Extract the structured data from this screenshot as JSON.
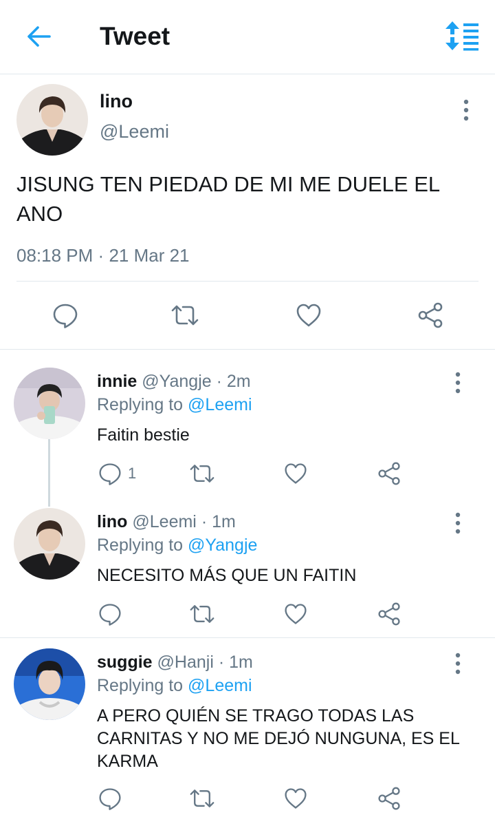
{
  "header": {
    "title": "Tweet",
    "accent": "#1da1f2",
    "back_icon": "arrow-left-icon",
    "sort_icon": "sort-arrows-icon"
  },
  "main_tweet": {
    "name": "lino",
    "handle": "@Leemi",
    "text": "JISUNG TEN PIEDAD DE MI ME DUELE EL ANO",
    "time": "08:18 PM",
    "sep": "·",
    "date": "21 Mar 21",
    "actions": [
      "reply-icon",
      "retweet-icon",
      "like-icon",
      "share-icon"
    ]
  },
  "replies": [
    {
      "name": "innie",
      "handle": "@Yangje",
      "sep": "·",
      "time": "2m",
      "replying_prefix": "Replying to",
      "replying_to": "@Leemi",
      "text": "Faitin bestie",
      "reply_count": "1"
    },
    {
      "name": "lino",
      "handle": "@Leemi",
      "sep": "·",
      "time": "1m",
      "replying_prefix": "Replying to",
      "replying_to": "@Yangje",
      "text": "NECESITO MÁS QUE UN FAITIN",
      "reply_count": ""
    },
    {
      "name": "suggie",
      "handle": "@Hanji",
      "sep": "·",
      "time": "1m",
      "replying_prefix": "Replying to",
      "replying_to": "@Leemi",
      "text": "A PERO QUIÉN SE TRAGO TODAS LAS CARNITAS Y NO ME DEJÓ NUNGUNA, ES EL KARMA",
      "reply_count": ""
    }
  ],
  "colors": {
    "text": "#14171a",
    "muted": "#657786",
    "accent": "#1da1f2",
    "divider": "#e1e8ed"
  }
}
